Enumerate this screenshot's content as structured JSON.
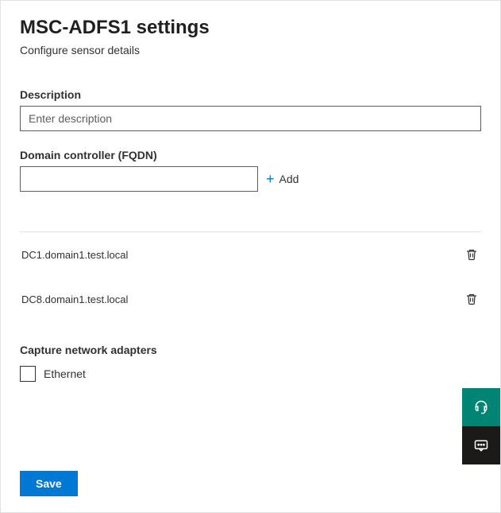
{
  "header": {
    "title": "MSC-ADFS1 settings",
    "subtitle": "Configure sensor details"
  },
  "description": {
    "label": "Description",
    "placeholder": "Enter description",
    "value": ""
  },
  "fqdn": {
    "label": "Domain controller (FQDN)",
    "value": "",
    "add_label": "Add"
  },
  "domain_controllers": [
    {
      "name": "DC1.domain1.test.local"
    },
    {
      "name": "DC8.domain1.test.local"
    }
  ],
  "adapters": {
    "label": "Capture network adapters",
    "items": [
      {
        "label": "Ethernet",
        "checked": false
      }
    ]
  },
  "actions": {
    "save": "Save"
  }
}
